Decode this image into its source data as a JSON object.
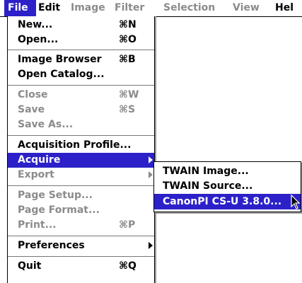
{
  "menubar": {
    "items": [
      {
        "label": "File",
        "state": "active"
      },
      {
        "label": "Edit",
        "state": "enabled"
      },
      {
        "label": "Image",
        "state": "disabled"
      },
      {
        "label": "Filter",
        "state": "disabled"
      },
      {
        "label": "Selection",
        "state": "disabled"
      },
      {
        "label": "View",
        "state": "disabled"
      },
      {
        "label": "Hel",
        "state": "enabled"
      }
    ]
  },
  "file_menu": {
    "items": [
      {
        "label": "New...",
        "shortcut": "⌘N",
        "state": "enabled"
      },
      {
        "label": "Open...",
        "shortcut": "⌘O",
        "state": "enabled"
      },
      {
        "label": "Image Browser",
        "shortcut": "⌘B",
        "state": "enabled"
      },
      {
        "label": "Open Catalog...",
        "shortcut": "",
        "state": "enabled"
      },
      {
        "label": "Close",
        "shortcut": "⌘W",
        "state": "disabled"
      },
      {
        "label": "Save",
        "shortcut": "⌘S",
        "state": "disabled"
      },
      {
        "label": "Save As...",
        "shortcut": "",
        "state": "disabled"
      },
      {
        "label": "Acquisition Profile...",
        "shortcut": "",
        "state": "enabled"
      },
      {
        "label": "Acquire",
        "shortcut": "",
        "state": "highlighted",
        "submenu": true
      },
      {
        "label": "Export",
        "shortcut": "",
        "state": "disabled",
        "submenu": true
      },
      {
        "label": "Page Setup...",
        "shortcut": "",
        "state": "disabled"
      },
      {
        "label": "Page Format...",
        "shortcut": "",
        "state": "disabled"
      },
      {
        "label": "Print...",
        "shortcut": "⌘P",
        "state": "disabled"
      },
      {
        "label": "Preferences",
        "shortcut": "",
        "state": "enabled",
        "submenu": true
      },
      {
        "label": "Quit",
        "shortcut": "⌘Q",
        "state": "enabled"
      }
    ]
  },
  "acquire_submenu": {
    "items": [
      {
        "label": "TWAIN Image...",
        "state": "enabled"
      },
      {
        "label": "TWAIN Source...",
        "state": "enabled"
      },
      {
        "label": "CanonPI CS-U 3.8.0...",
        "state": "highlighted"
      }
    ]
  },
  "colors": {
    "highlight": "#2c21c8",
    "disabled_text": "#8b8b8b",
    "text": "#000000",
    "background": "#ffffff"
  }
}
